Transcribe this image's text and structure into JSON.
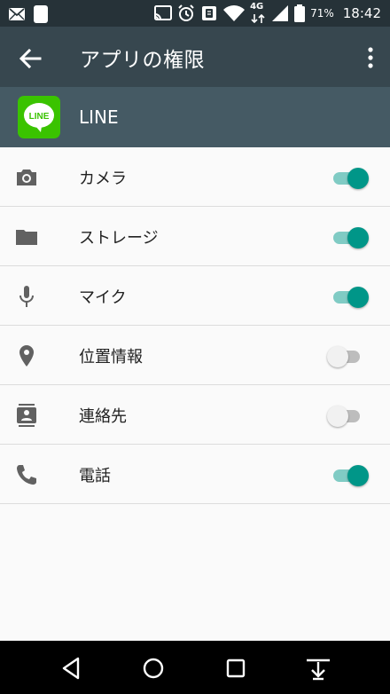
{
  "status_bar": {
    "icons": [
      "mail-icon",
      "notification-icon",
      "cast-icon",
      "alarm-icon",
      "vibrate-icon",
      "wifi-icon",
      "network-4g-icon",
      "signal-icon",
      "battery-icon"
    ],
    "network_label": "4G",
    "battery_percent": "71%",
    "time": "18:42"
  },
  "app_bar": {
    "title": "アプリの権限",
    "back_icon": "arrow-back-icon",
    "menu_icon": "more-vert-icon"
  },
  "app": {
    "name": "LINE",
    "logo_text": "LINE",
    "brand_color": "#3ac300"
  },
  "permissions": [
    {
      "label": "カメラ",
      "icon": "camera-icon",
      "enabled": true
    },
    {
      "label": "ストレージ",
      "icon": "folder-icon",
      "enabled": true
    },
    {
      "label": "マイク",
      "icon": "microphone-icon",
      "enabled": true
    },
    {
      "label": "位置情報",
      "icon": "location-icon",
      "enabled": false
    },
    {
      "label": "連絡先",
      "icon": "contacts-icon",
      "enabled": false
    },
    {
      "label": "電話",
      "icon": "phone-icon",
      "enabled": true
    }
  ],
  "colors": {
    "status_bar": "#263238",
    "app_bar": "#37474f",
    "app_header": "#455a64",
    "toggle_on": "#009688",
    "toggle_off": "#bdbdbd"
  },
  "nav_bar": {
    "icons": [
      "back-triangle-icon",
      "home-circle-icon",
      "recents-square-icon",
      "hide-keyboard-icon"
    ]
  }
}
